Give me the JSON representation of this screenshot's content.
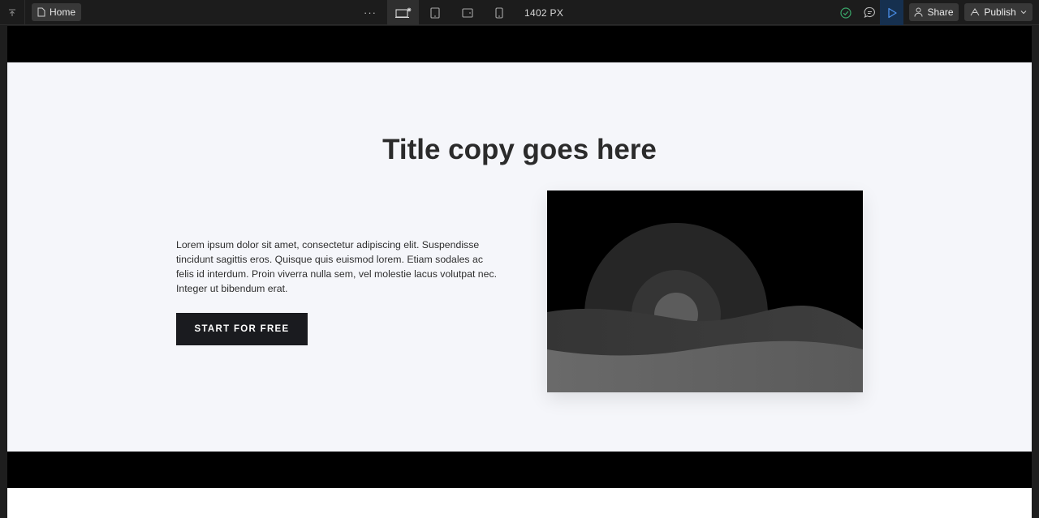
{
  "toolbar": {
    "page_name": "Home",
    "more_label": "···",
    "canvas_width_readout": "1402 PX",
    "share_label": "Share",
    "publish_label": "Publish",
    "devices": [
      "desktop-icon",
      "tablet-portrait-icon",
      "tablet-landscape-icon",
      "mobile-icon"
    ],
    "active_device": "desktop"
  },
  "page": {
    "hero": {
      "title": "Title copy goes here",
      "body": "Lorem ipsum dolor sit amet, consectetur adipiscing elit. Suspendisse tincidunt sagittis eros. Quisque quis euismod lorem. Etiam sodales ac felis id interdum. Proin viverra nulla sem, vel molestie lacus volutpat nec. Integer ut bibendum erat.",
      "cta_label": "START FOR FREE",
      "image": "landscape-placeholder-image"
    }
  },
  "colors": {
    "toolbar_bg": "#1c1c1c",
    "button_bg": "#383838",
    "preview_active_bg": "#16304f",
    "accent_blue": "#4a8ee8",
    "status_green": "#3aa66a",
    "hero_bg": "#f5f6fa",
    "band_black": "#000000",
    "cta_bg": "#1a1b1f"
  }
}
